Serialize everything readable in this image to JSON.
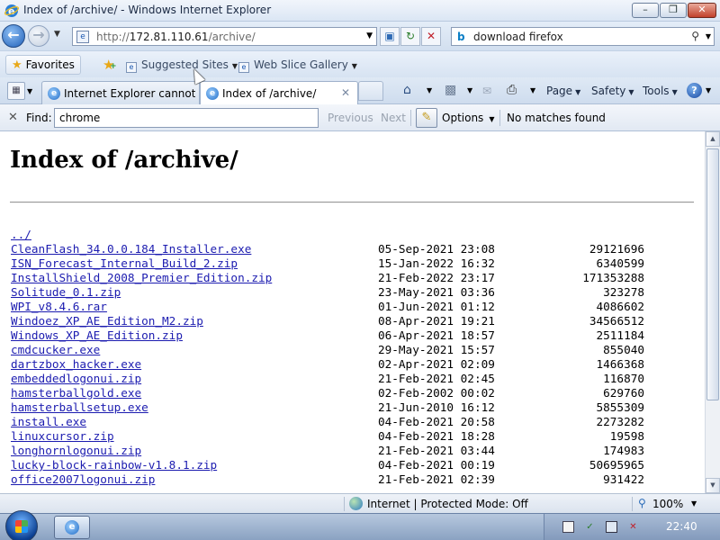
{
  "window": {
    "title": "Index of /archive/ - Windows Internet Explorer",
    "min_label": "–",
    "max_label": "❐",
    "close_label": "✕"
  },
  "address": {
    "url_prefix": "http://",
    "url_host": "172.81.110.61",
    "url_path": "/archive/"
  },
  "search": {
    "query": "download firefox"
  },
  "favorites": {
    "label": "Favorites",
    "links": [
      {
        "label": "Suggested Sites"
      },
      {
        "label": "Web Slice Gallery"
      }
    ]
  },
  "tabs": [
    {
      "label": "Internet Explorer cannot d...",
      "active": false
    },
    {
      "label": "Index of /archive/",
      "active": true
    }
  ],
  "command_bar": {
    "page": "Page",
    "safety": "Safety",
    "tools": "Tools"
  },
  "find_bar": {
    "label": "Find:",
    "value": "chrome",
    "previous": "Previous",
    "next": "Next",
    "options": "Options",
    "status": "No matches found"
  },
  "page": {
    "title": "Index of /archive/",
    "files": [
      {
        "name": "../",
        "date": "",
        "size": ""
      },
      {
        "name": "CleanFlash_34.0.0.184_Installer.exe",
        "date": "05-Sep-2021 23:08",
        "size": "29121696"
      },
      {
        "name": "ISN_Forecast_Internal_Build_2.zip",
        "date": "15-Jan-2022 16:32",
        "size": "6340599"
      },
      {
        "name": "InstallShield_2008_Premier_Edition.zip",
        "date": "21-Feb-2022 23:17",
        "size": "171353288"
      },
      {
        "name": "Solitude_0.1.zip",
        "date": "23-May-2021 03:36",
        "size": "323278"
      },
      {
        "name": "WPI_v8.4.6.rar",
        "date": "01-Jun-2021 01:12",
        "size": "4086602"
      },
      {
        "name": "Windoez_XP_AE_Edition_M2.zip",
        "date": "08-Apr-2021 19:21",
        "size": "34566512"
      },
      {
        "name": "Windows_XP_AE_Edition.zip",
        "date": "06-Apr-2021 18:57",
        "size": "2511184"
      },
      {
        "name": "cmdcucker.exe",
        "date": "29-May-2021 15:57",
        "size": "855040"
      },
      {
        "name": "dartzbox_hacker.exe",
        "date": "02-Apr-2021 02:09",
        "size": "1466368"
      },
      {
        "name": "embeddedlogonui.zip",
        "date": "21-Feb-2021 02:45",
        "size": "116870"
      },
      {
        "name": "hamsterballgold.exe",
        "date": "02-Feb-2002 00:02",
        "size": "629760"
      },
      {
        "name": "hamsterballsetup.exe",
        "date": "21-Jun-2010 16:12",
        "size": "5855309"
      },
      {
        "name": "install.exe",
        "date": "04-Feb-2021 20:58",
        "size": "2273282"
      },
      {
        "name": "linuxcursor.zip",
        "date": "04-Feb-2021 18:28",
        "size": "19598"
      },
      {
        "name": "longhornlogonui.zip",
        "date": "21-Feb-2021 03:44",
        "size": "174983"
      },
      {
        "name": "lucky-block-rainbow-v1.8.1.zip",
        "date": "04-Feb-2021 00:19",
        "size": "50695965"
      },
      {
        "name": "office2007logonui.zip",
        "date": "21-Feb-2021 02:39",
        "size": "931422"
      }
    ]
  },
  "status_bar": {
    "zone": "Internet | Protected Mode: Off",
    "zoom": "100%"
  },
  "taskbar": {
    "clock": "22:40"
  }
}
